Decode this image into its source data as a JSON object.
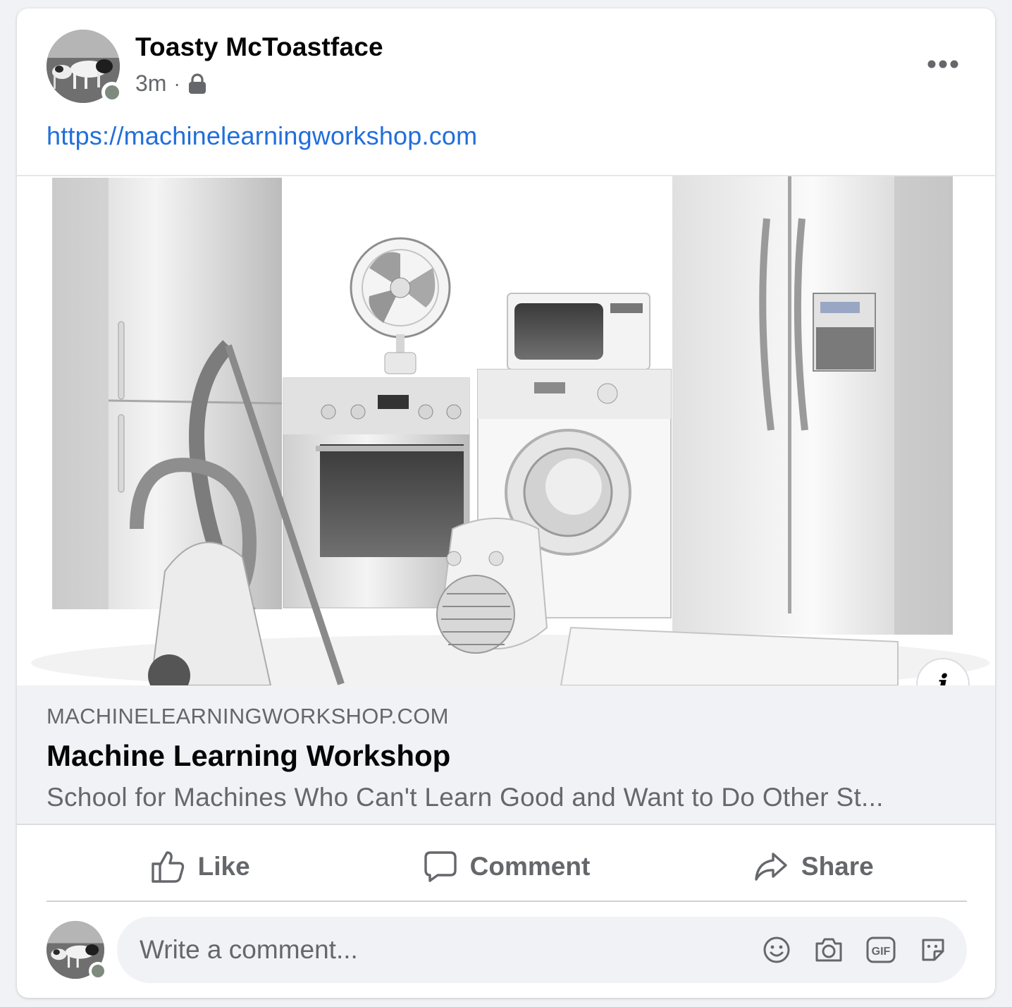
{
  "post": {
    "author": "Toasty McToastface",
    "time": "3m",
    "separator": "·",
    "privacy_icon": "lock-icon",
    "link_text": "https://machinelearningworkshop.com"
  },
  "preview": {
    "domain": "MACHINELEARNINGWORKSHOP.COM",
    "title": "Machine Learning Workshop",
    "description": "School for Machines Who Can't Learn Good and Want to Do Other St...",
    "info_label": "i"
  },
  "actions": {
    "like": "Like",
    "comment": "Comment",
    "share": "Share"
  },
  "composer": {
    "placeholder": "Write a comment...",
    "icons": [
      "emoji-icon",
      "camera-icon",
      "gif-icon",
      "sticker-icon"
    ]
  },
  "colors": {
    "link": "#216fdb",
    "secondary_text": "#65676b",
    "background": "#f0f2f5"
  }
}
